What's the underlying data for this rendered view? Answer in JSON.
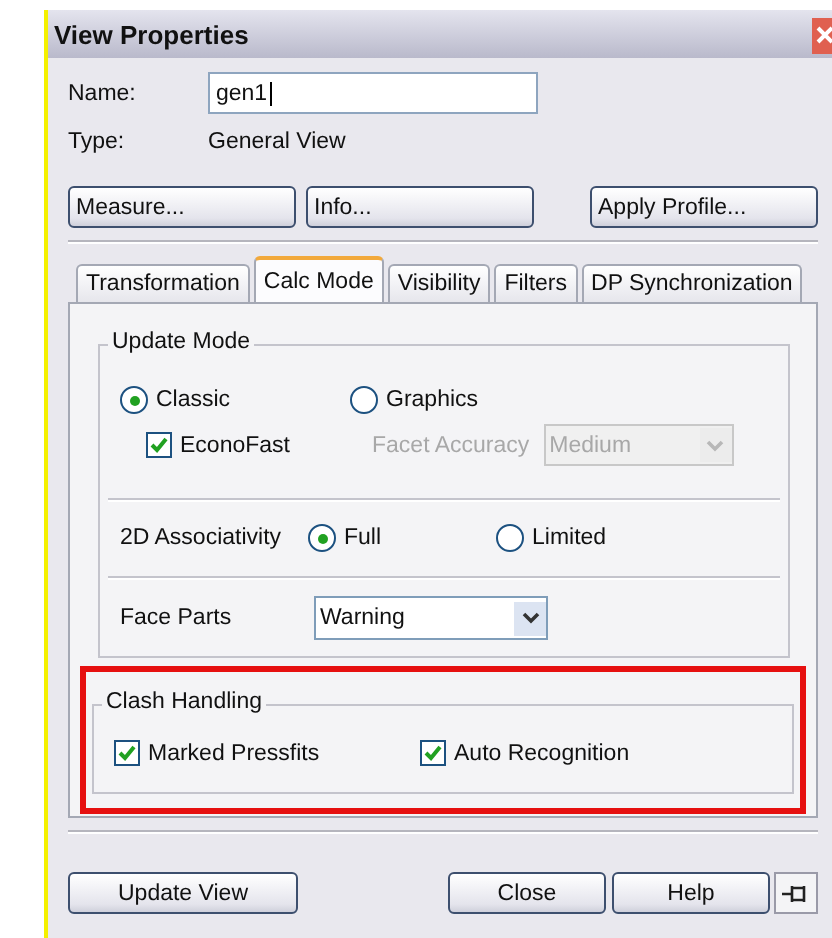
{
  "window": {
    "title": "View Properties"
  },
  "name": {
    "label": "Name:",
    "value": "gen1"
  },
  "type": {
    "label": "Type:",
    "value": "General View"
  },
  "top_buttons": [
    "Measure...",
    "Info...",
    "Apply Profile..."
  ],
  "tabs": [
    {
      "label": "Transformation",
      "selected": false
    },
    {
      "label": "Calc Mode",
      "selected": true
    },
    {
      "label": "Visibility",
      "selected": false
    },
    {
      "label": "Filters",
      "selected": false
    },
    {
      "label": "DP Synchronization",
      "selected": false
    }
  ],
  "update_mode": {
    "title": "Update Mode",
    "options": [
      {
        "label": "Classic",
        "selected": true
      },
      {
        "label": "Graphics",
        "selected": false
      }
    ],
    "econofast": {
      "label": "EconoFast",
      "checked": true
    },
    "facet_accuracy": {
      "label": "Facet Accuracy",
      "value": "Medium",
      "disabled": true
    }
  },
  "associativity": {
    "label": "2D Associativity",
    "options": [
      {
        "label": "Full",
        "selected": true
      },
      {
        "label": "Limited",
        "selected": false
      }
    ]
  },
  "face_parts": {
    "label": "Face Parts",
    "value": "Warning"
  },
  "clash_handling": {
    "title": "Clash Handling",
    "highlighted": true,
    "options": [
      {
        "label": "Marked Pressfits",
        "checked": true
      },
      {
        "label": "Auto Recognition",
        "checked": true
      }
    ]
  },
  "bottom_buttons": [
    "Update View",
    "Close",
    "Help"
  ]
}
